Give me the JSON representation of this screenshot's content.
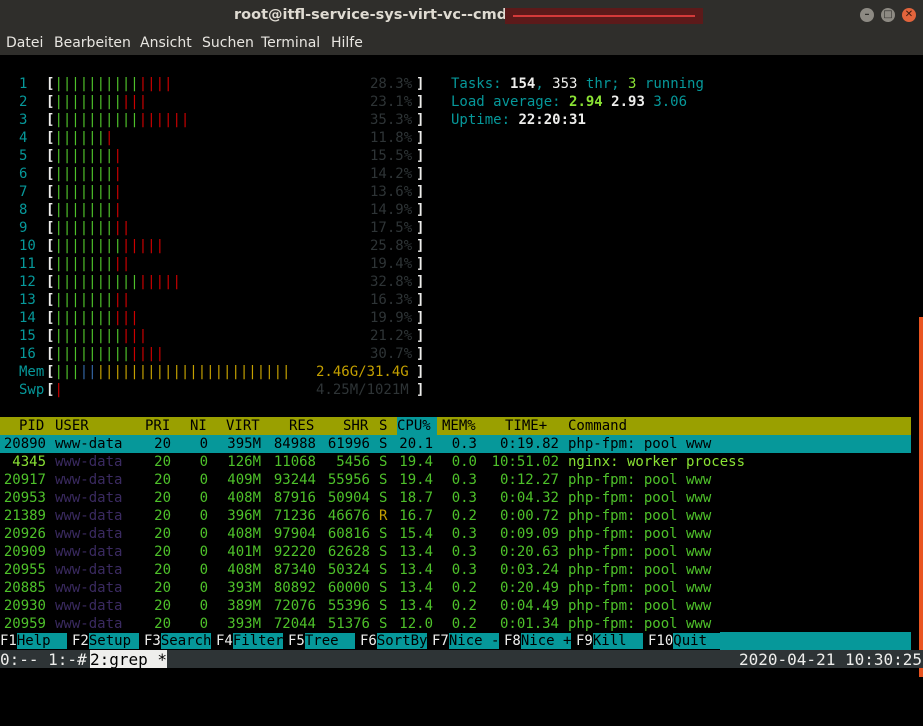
{
  "window": {
    "title": "root@itfl-service-sys-virt-vc--cmdb-20",
    "buttons": [
      "–",
      "□",
      "✕"
    ]
  },
  "menu": [
    "Datei",
    "Bearbeiten",
    "Ansicht",
    "Suchen",
    "Terminal",
    "Hilfe"
  ],
  "cpus": [
    {
      "id": "1",
      "pct": "28.3%",
      "g": 10,
      "r": 4
    },
    {
      "id": "2",
      "pct": "23.1%",
      "g": 8,
      "r": 3
    },
    {
      "id": "3",
      "pct": "35.3%",
      "g": 10,
      "r": 6
    },
    {
      "id": "4",
      "pct": "11.8%",
      "g": 6,
      "r": 1
    },
    {
      "id": "5",
      "pct": "15.5%",
      "g": 7,
      "r": 1
    },
    {
      "id": "6",
      "pct": "14.2%",
      "g": 7,
      "r": 1
    },
    {
      "id": "7",
      "pct": "13.6%",
      "g": 7,
      "r": 1
    },
    {
      "id": "8",
      "pct": "14.9%",
      "g": 7,
      "r": 1
    },
    {
      "id": "9",
      "pct": "17.5%",
      "g": 7,
      "r": 2
    },
    {
      "id": "10",
      "pct": "25.8%",
      "g": 8,
      "r": 5
    },
    {
      "id": "11",
      "pct": "19.4%",
      "g": 7,
      "r": 2
    },
    {
      "id": "12",
      "pct": "32.8%",
      "g": 10,
      "r": 5
    },
    {
      "id": "13",
      "pct": "16.3%",
      "g": 7,
      "r": 2
    },
    {
      "id": "14",
      "pct": "19.9%",
      "g": 7,
      "r": 3
    },
    {
      "id": "15",
      "pct": "21.2%",
      "g": 8,
      "r": 3
    },
    {
      "id": "16",
      "pct": "30.7%",
      "g": 9,
      "r": 4
    }
  ],
  "mem": {
    "label": "Mem",
    "value": "2.46G/31.4G"
  },
  "swp": {
    "label": "Swp",
    "value": "4.25M/1021M"
  },
  "summary": {
    "tasks_label": "Tasks: ",
    "tasks": "154",
    "thr_sep": ", ",
    "thr": "353",
    "thr_label": " thr; ",
    "running": "3",
    "running_label": " running",
    "load_label": "Load average: ",
    "load1": "2.94",
    "load5": "2.93",
    "load15": "3.06",
    "uptime_label": "Uptime: ",
    "uptime": "22:20:31"
  },
  "columns": {
    "pid": "PID",
    "user": "USER",
    "pri": "PRI",
    "ni": "NI",
    "virt": "VIRT",
    "res": "RES",
    "shr": "SHR",
    "s": "S",
    "cpu": "CPU%",
    "mem": "MEM%",
    "time": "TIME+",
    "cmd": "Command"
  },
  "processes": [
    {
      "pid": "20890",
      "user": "www-data",
      "pri": "20",
      "ni": "0",
      "virt": "395M",
      "res": "84988",
      "shr": "61996",
      "s": "S",
      "cpu": "20.1",
      "mem": "0.3",
      "time": "0:19.82",
      "cmd": "php-fpm: pool www"
    },
    {
      "pid": "4345",
      "user": "www-data",
      "pri": "20",
      "ni": "0",
      "virt": "126M",
      "res": "11068",
      "shr": "5456",
      "s": "S",
      "cpu": "19.4",
      "mem": "0.0",
      "time": "10:51.02",
      "cmd": "nginx: worker process"
    },
    {
      "pid": "20917",
      "user": "www-data",
      "pri": "20",
      "ni": "0",
      "virt": "409M",
      "res": "93244",
      "shr": "55956",
      "s": "S",
      "cpu": "19.4",
      "mem": "0.3",
      "time": "0:12.27",
      "cmd": "php-fpm: pool www"
    },
    {
      "pid": "20953",
      "user": "www-data",
      "pri": "20",
      "ni": "0",
      "virt": "408M",
      "res": "87916",
      "shr": "50904",
      "s": "S",
      "cpu": "18.7",
      "mem": "0.3",
      "time": "0:04.32",
      "cmd": "php-fpm: pool www"
    },
    {
      "pid": "21389",
      "user": "www-data",
      "pri": "20",
      "ni": "0",
      "virt": "396M",
      "res": "71236",
      "shr": "46676",
      "s": "R",
      "cpu": "16.7",
      "mem": "0.2",
      "time": "0:00.72",
      "cmd": "php-fpm: pool www"
    },
    {
      "pid": "20926",
      "user": "www-data",
      "pri": "20",
      "ni": "0",
      "virt": "408M",
      "res": "97904",
      "shr": "60816",
      "s": "S",
      "cpu": "15.4",
      "mem": "0.3",
      "time": "0:09.09",
      "cmd": "php-fpm: pool www"
    },
    {
      "pid": "20909",
      "user": "www-data",
      "pri": "20",
      "ni": "0",
      "virt": "401M",
      "res": "92220",
      "shr": "62628",
      "s": "S",
      "cpu": "13.4",
      "mem": "0.3",
      "time": "0:20.63",
      "cmd": "php-fpm: pool www"
    },
    {
      "pid": "20955",
      "user": "www-data",
      "pri": "20",
      "ni": "0",
      "virt": "408M",
      "res": "87340",
      "shr": "50324",
      "s": "S",
      "cpu": "13.4",
      "mem": "0.3",
      "time": "0:03.24",
      "cmd": "php-fpm: pool www"
    },
    {
      "pid": "20885",
      "user": "www-data",
      "pri": "20",
      "ni": "0",
      "virt": "393M",
      "res": "80892",
      "shr": "60000",
      "s": "S",
      "cpu": "13.4",
      "mem": "0.2",
      "time": "0:20.49",
      "cmd": "php-fpm: pool www"
    },
    {
      "pid": "20930",
      "user": "www-data",
      "pri": "20",
      "ni": "0",
      "virt": "389M",
      "res": "72076",
      "shr": "55396",
      "s": "S",
      "cpu": "13.4",
      "mem": "0.2",
      "time": "0:04.49",
      "cmd": "php-fpm: pool www"
    },
    {
      "pid": "20959",
      "user": "www-data",
      "pri": "20",
      "ni": "0",
      "virt": "393M",
      "res": "72044",
      "shr": "51376",
      "s": "S",
      "cpu": "12.0",
      "mem": "0.2",
      "time": "0:01.34",
      "cmd": "php-fpm: pool www"
    }
  ],
  "fkeys": [
    {
      "k": "F1",
      "v": "Help  "
    },
    {
      "k": "F2",
      "v": "Setup "
    },
    {
      "k": "F3",
      "v": "Search"
    },
    {
      "k": "F4",
      "v": "Filter"
    },
    {
      "k": "F5",
      "v": "Tree  "
    },
    {
      "k": "F6",
      "v": "SortBy"
    },
    {
      "k": "F7",
      "v": "Nice -"
    },
    {
      "k": "F8",
      "v": "Nice +"
    },
    {
      "k": "F9",
      "v": "Kill  "
    },
    {
      "k": "F10",
      "v": "Quit  "
    }
  ],
  "tmux": {
    "left": "0:-- 1:-# ",
    "active": "2:grep *",
    "datetime": "2020-04-21 10:30:25"
  },
  "colors": {
    "accent": "#06989a",
    "header": "#9aa000",
    "green": "#4ec12a",
    "red": "#cc0000"
  }
}
